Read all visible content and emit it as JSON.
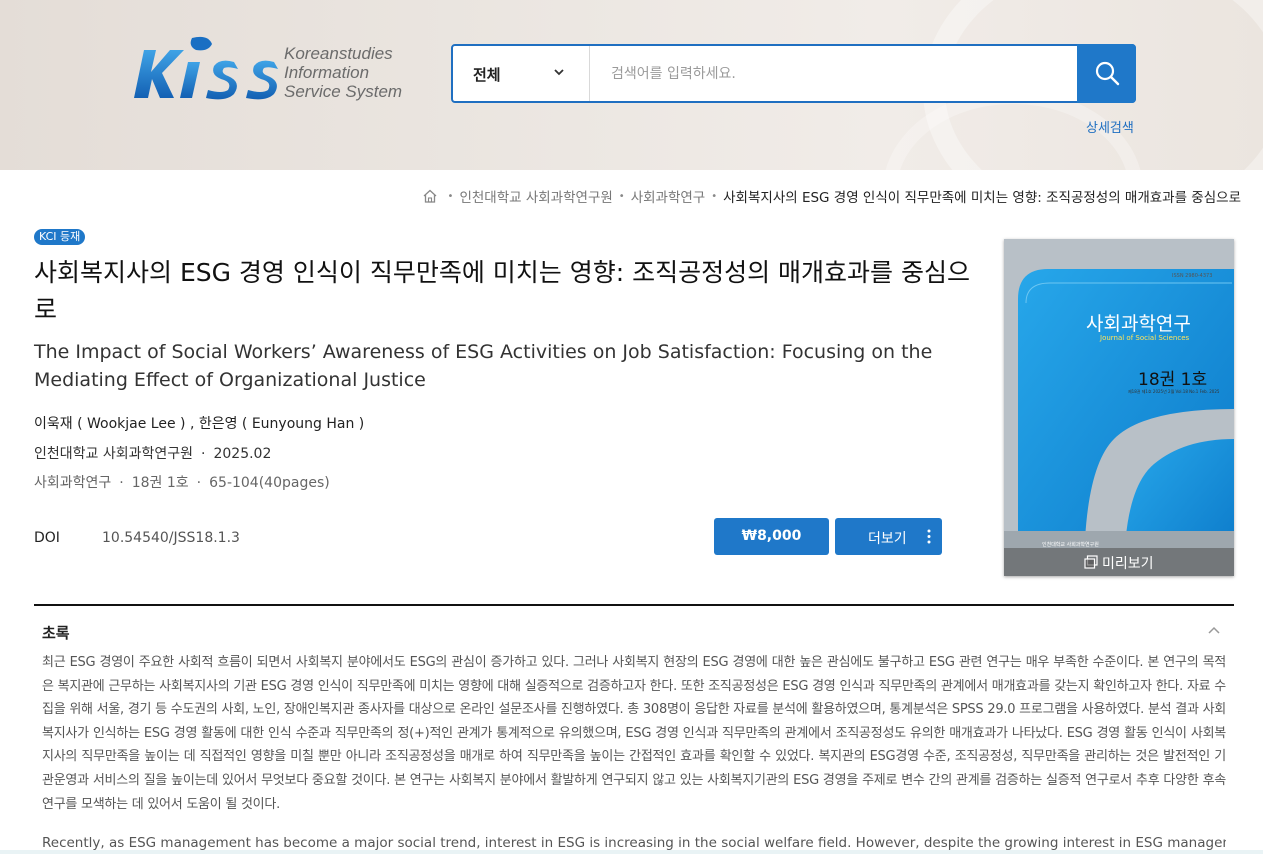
{
  "header": {
    "logo_line1": "Koreanstudies",
    "logo_line2": "Information",
    "logo_line3": "Service System",
    "search_scope": "전체",
    "search_placeholder": "검색어를 입력하세요.",
    "advanced_search": "상세검색"
  },
  "breadcrumb": {
    "items": [
      "인천대학교 사회과학연구원",
      "사회과학연구",
      "사회복지사의 ESG 경영 인식이 직무만족에 미치는 영향: 조직공정성의 매개효과를 중심으로"
    ]
  },
  "article": {
    "badge": "KCI 등재",
    "title_ko": "사회복지사의 ESG 경영 인식이 직무만족에 미치는 영향: 조직공정성의 매개효과를 중심으로",
    "title_en": "The Impact of Social Workers’ Awareness of ESG Activities on Job Satisfaction: Focusing on the Mediating Effect of Organizational Justice",
    "authors": "이욱재 ( Wookjae Lee ) , 한은영 ( Eunyoung Han )",
    "publisher": "인천대학교 사회과학연구원",
    "date": "2025.02",
    "journal": "사회과학연구",
    "volume": "18권 1호",
    "pages": "65-104(40pages)",
    "doi_label": "DOI",
    "doi": "10.54540/JSS18.1.3",
    "price": "₩8,000",
    "more": "더보기"
  },
  "cover": {
    "issn": "ISSN 2980-4373",
    "title": "사회과학연구",
    "subtitle": "Journal of Social Sciences",
    "volume": "18권 1호",
    "small": "제18권 제1호 2025년 2월 Vol.18 No.1 Feb. 2025",
    "publisher": "인천대학교 사회과학연구원",
    "preview": "미리보기"
  },
  "abstract": {
    "title": "초록",
    "ko": "최근 ESG 경영이 주요한 사회적 흐름이 되면서 사회복지 분야에서도 ESG의 관심이 증가하고 있다. 그러나 사회복지 현장의 ESG 경영에 대한 높은 관심에도 불구하고 ESG 관련 연구는 매우 부족한 수준이다. 본 연구의 목적은 복지관에 근무하는 사회복지사의 기관 ESG 경영 인식이 직무만족에 미치는 영향에 대해 실증적으로 검증하고자 한다. 또한 조직공정성은 ESG 경영 인식과 직무만족의 관계에서 매개효과를 갖는지 확인하고자 한다. 자료 수집을 위해 서울, 경기 등 수도권의 사회, 노인, 장애인복지관 종사자를 대상으로 온라인 설문조사를 진행하였다. 총 308명이 응답한 자료를 분석에 활용하였으며, 통계분석은 SPSS 29.0 프로그램을 사용하였다. 분석 결과 사회복지사가 인식하는 ESG 경영 활동에 대한 인식 수준과 직무만족의 정(+)적인 관계가 통계적으로 유의했으며, ESG 경영 인식과 직무만족의 관계에서 조직공정성도 유의한 매개효과가 나타났다. ESG 경영 활동 인식이 사회복지사의 직무만족을 높이는 데 직접적인 영향을 미칠 뿐만 아니라 조직공정성을 매개로 하여 직무만족을 높이는 간접적인 효과를 확인할 수 있었다. 복지관의 ESG경영 수준, 조직공정성, 직무만족을 관리하는 것은 발전적인 기관운영과 서비스의 질을 높이는데 있어서 무엇보다 중요할 것이다. 본 연구는 사회복지 분야에서 활발하게 연구되지 않고 있는 사회복지기관의 ESG 경영을 주제로 변수 간의 관계를 검증하는 실증적 연구로서 추후 다양한 후속 연구를 모색하는 데 있어서 도움이 될 것이다.",
    "en": "Recently, as ESG management has become a major social trend, interest in ESG is increasing in the social welfare field. However, despite the growing interest in ESG management, research"
  },
  "colors": {
    "accent": "#1f78c9",
    "search_border": "#1f6fc1"
  }
}
